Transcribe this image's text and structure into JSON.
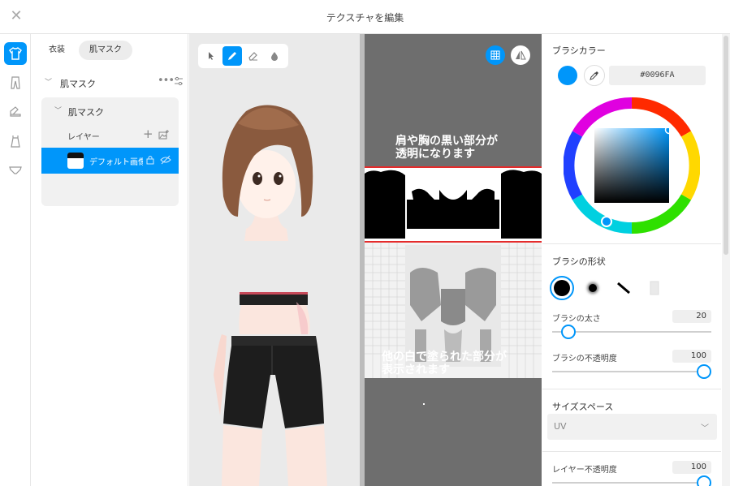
{
  "window": {
    "title": "テクスチャを編集",
    "close_icon": "close-icon"
  },
  "rail": {
    "items": [
      "shirt-icon",
      "pants-icon",
      "shoe-icon",
      "dress-icon",
      "underwear-icon"
    ],
    "active": 0
  },
  "layers": {
    "tabs": [
      {
        "label": "衣装"
      },
      {
        "label": "肌マスク"
      }
    ],
    "active_tab": 1,
    "group": {
      "label": "肌マスク",
      "more": "•••"
    },
    "subgroup": {
      "label": "肌マスク"
    },
    "layer_header": {
      "label": "レイヤー",
      "plus": "+"
    },
    "item": {
      "name": "デフォルト画像"
    }
  },
  "uv": {
    "note_top": "肩や胸の黒い部分が\n透明になります",
    "note_bottom": "他の白で塗られた部分が\n表示されます"
  },
  "panel": {
    "color": {
      "title": "ブラシカラー",
      "hex": "#0096FA",
      "value": "#0096FA"
    },
    "shape": {
      "title": "ブラシの形状"
    },
    "size": {
      "label": "ブラシの太さ",
      "value": "20",
      "level": 20
    },
    "opacity": {
      "label": "ブラシの不透明度",
      "value": "100",
      "level": 100
    },
    "space": {
      "title": "サイズスペース",
      "selected": "UV"
    },
    "layer_opacity": {
      "label": "レイヤー不透明度",
      "value": "100",
      "level": 100
    }
  },
  "colors": {
    "accent": "#0096FA",
    "uv_bg": "#6e6e6e",
    "highlight": "#e52b2b"
  }
}
